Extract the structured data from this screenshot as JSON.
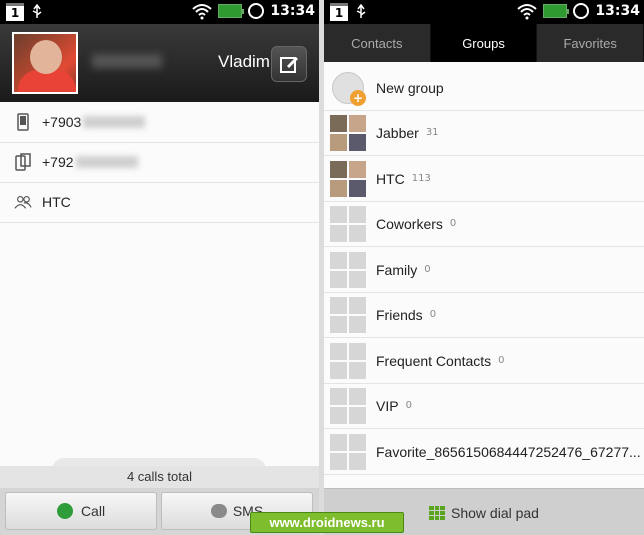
{
  "status_bar": {
    "calendar_day": "1",
    "time": "13:34"
  },
  "contact": {
    "name": "Vladimi",
    "details": [
      {
        "icon": "mobile-phone-icon",
        "value": "+7903"
      },
      {
        "icon": "work-phone-icon",
        "value": "+792"
      },
      {
        "icon": "group-icon",
        "value": "HTC"
      }
    ],
    "calls_total": "4 calls total",
    "call_label": "Call",
    "sms_label": "SMS"
  },
  "watermark": "www.droidnews.ru",
  "tabs": [
    {
      "label": "Contacts",
      "active": false
    },
    {
      "label": "Groups",
      "active": true
    },
    {
      "label": "Favorites",
      "active": false
    }
  ],
  "groups": {
    "new_group_label": "New group",
    "items": [
      {
        "name": "Jabber",
        "count": "31",
        "photos": true
      },
      {
        "name": "HTC",
        "count": "113",
        "photos": true
      },
      {
        "name": "Coworkers",
        "count": "0",
        "photos": false
      },
      {
        "name": "Family",
        "count": "0",
        "photos": false
      },
      {
        "name": "Friends",
        "count": "0",
        "photos": false
      },
      {
        "name": "Frequent Contacts",
        "count": "0",
        "photos": false
      },
      {
        "name": "VIP",
        "count": "0",
        "photos": false
      },
      {
        "name": "Favorite_8656150684447252476_67277...",
        "count": "",
        "photos": false
      }
    ],
    "dial_pad_label": "Show dial pad"
  },
  "colors": {
    "accent_green": "#5aa51f",
    "call_green": "#2f9c3a",
    "header_dark": "#1a1a1a"
  }
}
